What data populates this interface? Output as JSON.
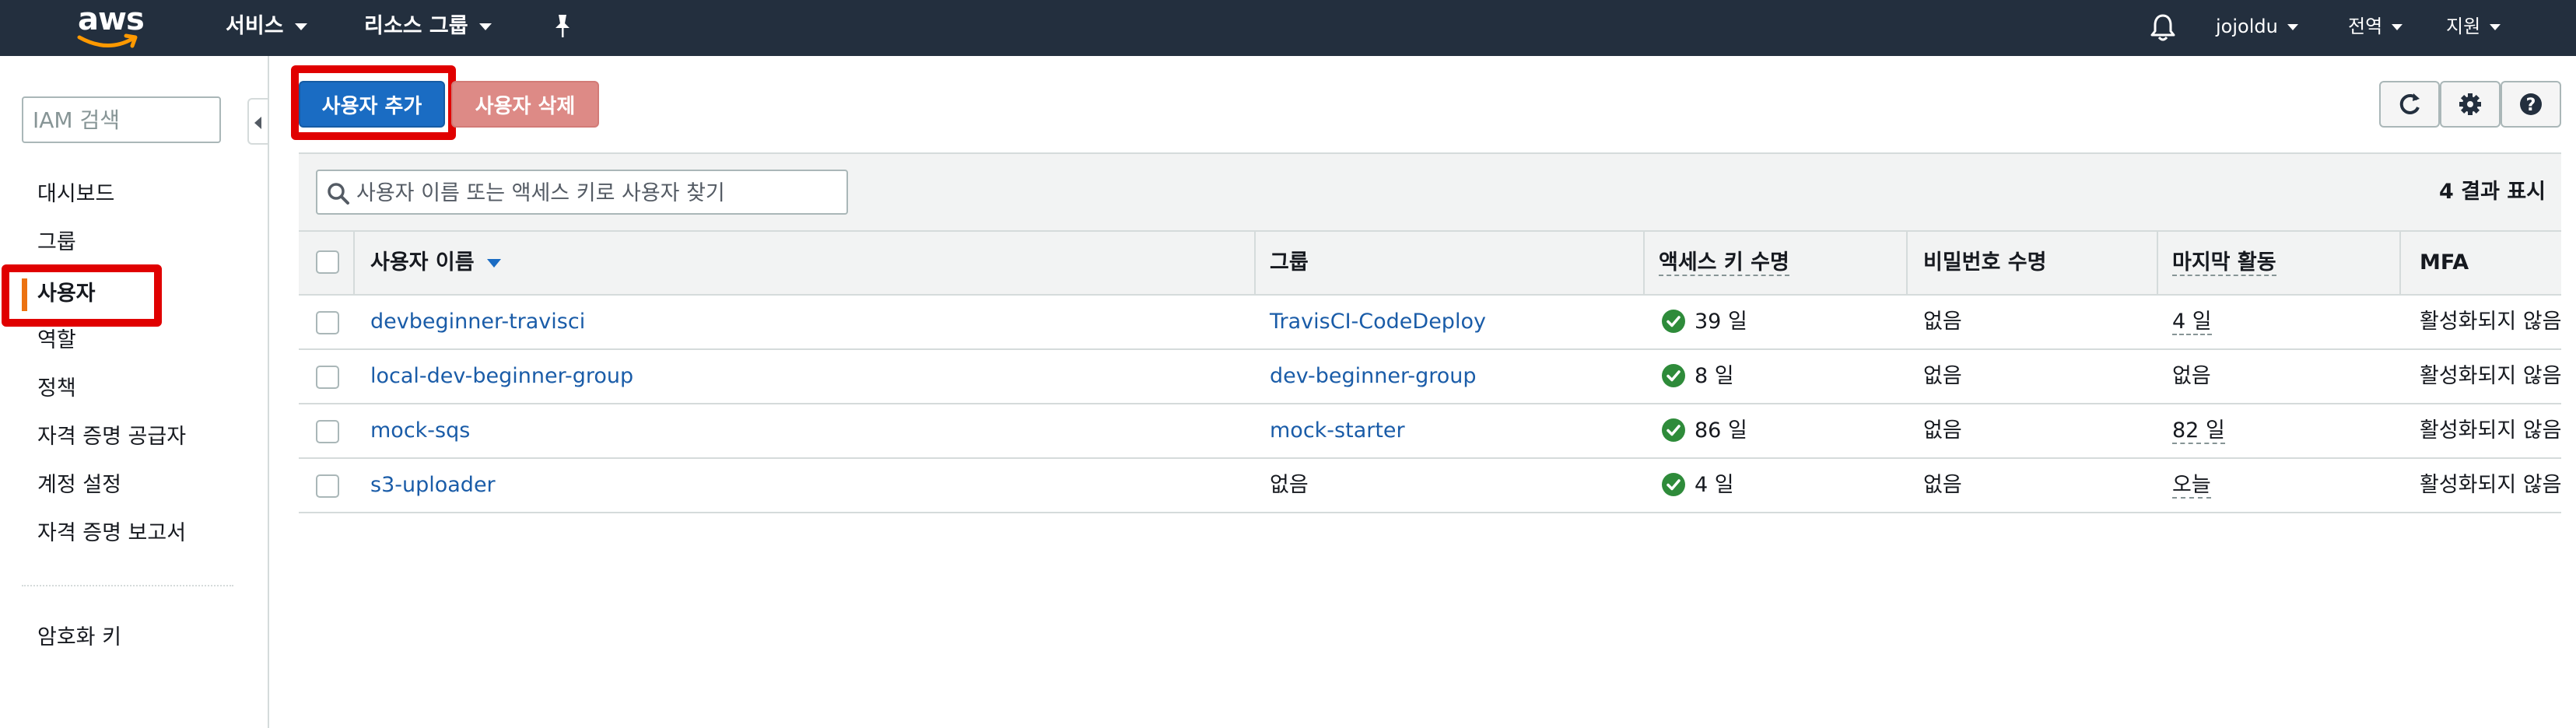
{
  "brand": {
    "logo_text": "aws"
  },
  "topnav": {
    "services": "서비스",
    "resource_groups": "리소스 그룹",
    "user": "jojoldu",
    "region": "전역",
    "support": "지원"
  },
  "sidebar": {
    "search_placeholder": "IAM 검색",
    "items": [
      {
        "label": "대시보드"
      },
      {
        "label": "그룹"
      },
      {
        "label": "사용자",
        "active": true
      },
      {
        "label": "역할"
      },
      {
        "label": "정책"
      },
      {
        "label": "자격 증명 공급자"
      },
      {
        "label": "계정 설정"
      },
      {
        "label": "자격 증명 보고서"
      }
    ],
    "encryption_keys": "암호화 키"
  },
  "toolbar": {
    "add_user": "사용자 추가",
    "delete_user": "사용자 삭제",
    "icons": [
      "refresh-icon",
      "gear-icon",
      "help-icon"
    ]
  },
  "table": {
    "search_placeholder": "사용자 이름 또는 액세스 키로 사용자 찾기",
    "result_count": "4 결과 표시",
    "columns": {
      "user_name": "사용자 이름",
      "groups": "그룹",
      "access_key_age": "액세스 키 수명",
      "password_age": "비밀번호 수명",
      "last_activity": "마지막 활동",
      "mfa": "MFA"
    },
    "rows": [
      {
        "user_name": "devbeginner-travisci",
        "groups": "TravisCI-CodeDeploy",
        "access_key_age": "39 일",
        "password_age": "없음",
        "last_activity": "4 일",
        "mfa": "활성화되지 않음"
      },
      {
        "user_name": "local-dev-beginner-group",
        "groups": "dev-beginner-group",
        "access_key_age": "8 일",
        "password_age": "없음",
        "last_activity": "없음",
        "mfa": "활성화되지 않음"
      },
      {
        "user_name": "mock-sqs",
        "groups": "mock-starter",
        "access_key_age": "86 일",
        "password_age": "없음",
        "last_activity": "82 일",
        "mfa": "활성화되지 않음"
      },
      {
        "user_name": "s3-uploader",
        "groups": "없음",
        "access_key_age": "4 일",
        "password_age": "없음",
        "last_activity": "오늘",
        "mfa": "활성화되지 않음"
      }
    ]
  },
  "colors": {
    "nav_bg": "#232f3e",
    "primary": "#1a6cc3",
    "danger": "#dd8a86",
    "active_accent": "#ec7211",
    "highlight": "#e00000",
    "link": "#1a5ca8",
    "ok": "#2e8b3a"
  }
}
